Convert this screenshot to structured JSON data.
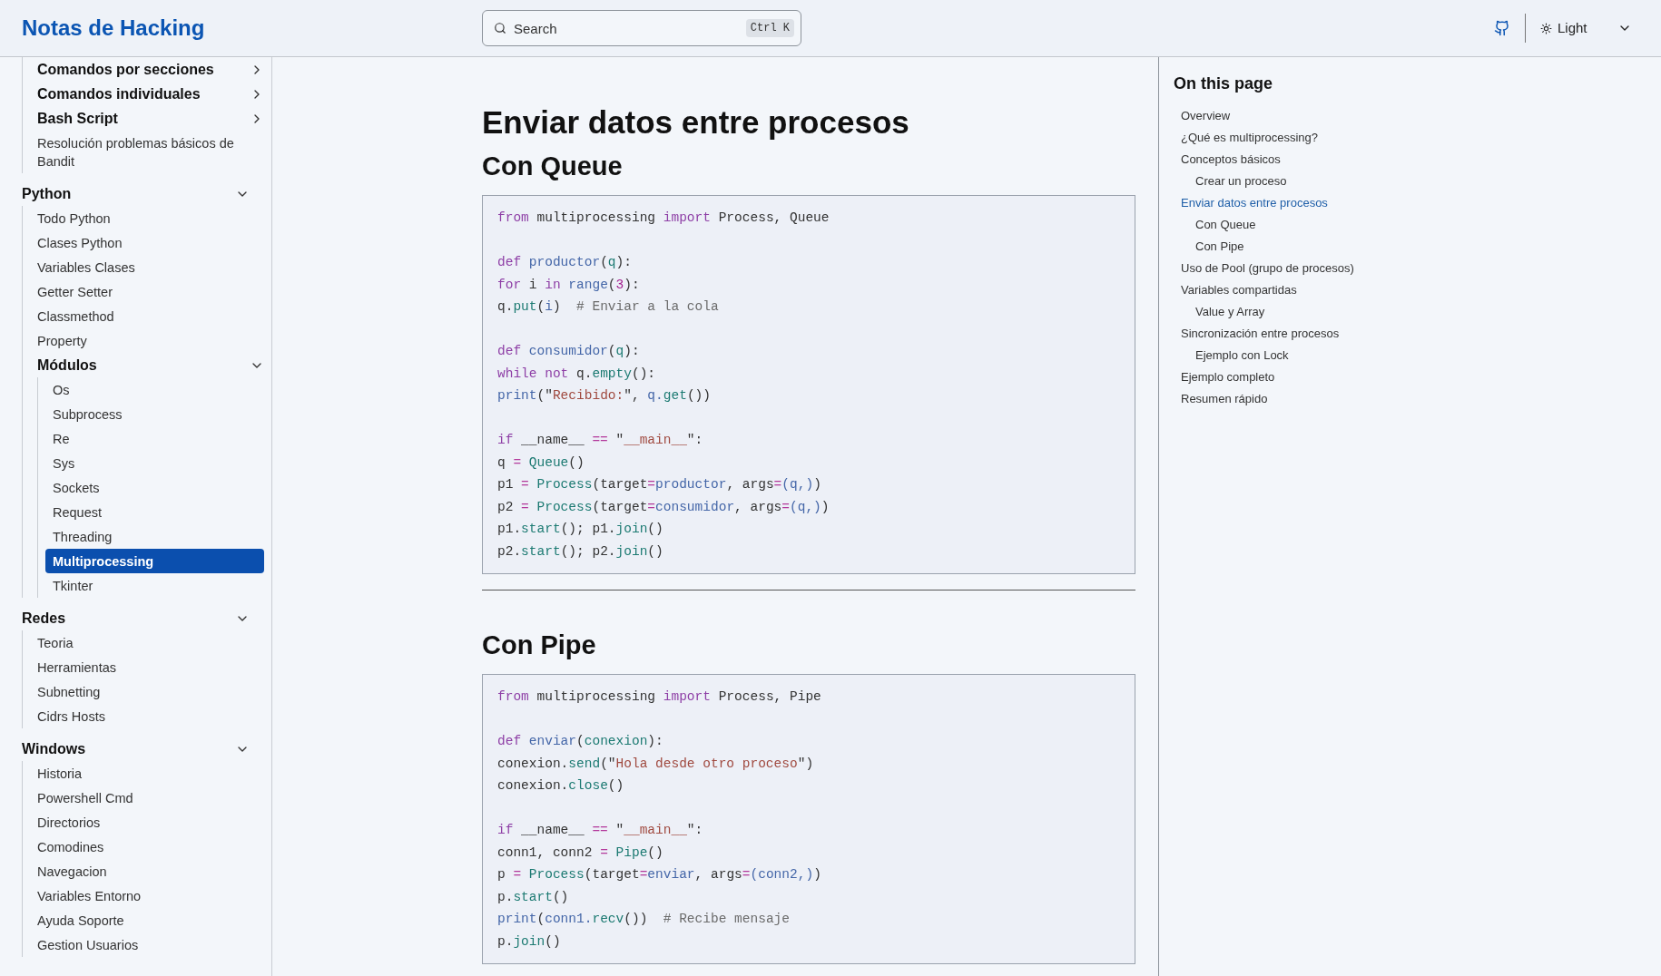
{
  "header": {
    "site_title": "Notas de Hacking",
    "search": {
      "placeholder": "Search",
      "shortcut": "Ctrl K"
    },
    "theme": {
      "label": "Light"
    }
  },
  "sidebar": {
    "continued_items": [
      {
        "label": "Comandos por secciones",
        "kind": "folder",
        "expanded": false,
        "selected": false
      },
      {
        "label": "Comandos individuales",
        "kind": "folder",
        "expanded": false,
        "selected": false
      },
      {
        "label": "Bash Script",
        "kind": "folder",
        "expanded": false,
        "selected": false
      },
      {
        "label": "Resolución problemas básicos de Bandit",
        "kind": "page",
        "selected": false
      }
    ],
    "sections": [
      {
        "label": "Python",
        "expanded": true,
        "children": [
          {
            "label": "Todo Python",
            "kind": "page",
            "selected": false
          },
          {
            "label": "Clases Python",
            "kind": "page",
            "selected": false
          },
          {
            "label": "Variables Clases",
            "kind": "page",
            "selected": false
          },
          {
            "label": "Getter Setter",
            "kind": "page",
            "selected": false
          },
          {
            "label": "Classmethod",
            "kind": "page",
            "selected": false
          },
          {
            "label": "Property",
            "kind": "page",
            "selected": false
          },
          {
            "label": "Módulos",
            "kind": "folder",
            "expanded": true,
            "selected": false,
            "children": [
              {
                "label": "Os",
                "kind": "page",
                "selected": false
              },
              {
                "label": "Subprocess",
                "kind": "page",
                "selected": false
              },
              {
                "label": "Re",
                "kind": "page",
                "selected": false
              },
              {
                "label": "Sys",
                "kind": "page",
                "selected": false
              },
              {
                "label": "Sockets",
                "kind": "page",
                "selected": false
              },
              {
                "label": "Request",
                "kind": "page",
                "selected": false
              },
              {
                "label": "Threading",
                "kind": "page",
                "selected": false
              },
              {
                "label": "Multiprocessing",
                "kind": "page",
                "selected": true
              },
              {
                "label": "Tkinter",
                "kind": "page",
                "selected": false
              }
            ]
          }
        ]
      },
      {
        "label": "Redes",
        "expanded": true,
        "children": [
          {
            "label": "Teoria",
            "kind": "page",
            "selected": false
          },
          {
            "label": "Herramientas",
            "kind": "page",
            "selected": false
          },
          {
            "label": "Subnetting",
            "kind": "page",
            "selected": false
          },
          {
            "label": "Cidrs Hosts",
            "kind": "page",
            "selected": false
          }
        ]
      },
      {
        "label": "Windows",
        "expanded": true,
        "children": [
          {
            "label": "Historia",
            "kind": "page",
            "selected": false
          },
          {
            "label": "Powershell Cmd",
            "kind": "page",
            "selected": false
          },
          {
            "label": "Directorios",
            "kind": "page",
            "selected": false
          },
          {
            "label": "Comodines",
            "kind": "page",
            "selected": false
          },
          {
            "label": "Navegacion",
            "kind": "page",
            "selected": false
          },
          {
            "label": "Variables Entorno",
            "kind": "page",
            "selected": false
          },
          {
            "label": "Ayuda Soporte",
            "kind": "page",
            "selected": false
          },
          {
            "label": "Gestion Usuarios",
            "kind": "page",
            "selected": false
          }
        ]
      }
    ]
  },
  "content": {
    "title": "Enviar datos entre procesos",
    "sections": [
      {
        "heading": "Con Queue",
        "divider_after": true,
        "code": [
          {
            "kind": "code",
            "tokens": [
              {
                "kind": "keyword",
                "text": "from"
              },
              {
                "kind": "plain",
                "text": " multiprocessing "
              },
              {
                "kind": "keyword",
                "text": "import"
              },
              {
                "kind": "plain",
                "text": " Process, Queue"
              }
            ]
          },
          {
            "kind": "blank"
          },
          {
            "kind": "code",
            "tokens": [
              {
                "kind": "keyword",
                "text": "def"
              },
              {
                "kind": "function",
                "text": " productor"
              },
              {
                "kind": "plain",
                "text": "("
              },
              {
                "kind": "call",
                "text": "q"
              },
              {
                "kind": "plain",
                "text": "):"
              }
            ]
          },
          {
            "kind": "code",
            "tokens": [
              {
                "kind": "keyword",
                "text": "for"
              },
              {
                "kind": "plain",
                "text": " i "
              },
              {
                "kind": "keyword",
                "text": "in"
              },
              {
                "kind": "function",
                "text": " range"
              },
              {
                "kind": "plain",
                "text": "("
              },
              {
                "kind": "number",
                "text": "3"
              },
              {
                "kind": "plain",
                "text": "):"
              }
            ]
          },
          {
            "kind": "code",
            "tokens": [
              {
                "kind": "plain",
                "text": "q."
              },
              {
                "kind": "call",
                "text": "put"
              },
              {
                "kind": "plain",
                "text": "("
              },
              {
                "kind": "function",
                "text": "i"
              },
              {
                "kind": "plain",
                "text": ")"
              },
              {
                "kind": "comment",
                "text": "  # Enviar a la cola"
              }
            ]
          },
          {
            "kind": "blank"
          },
          {
            "kind": "code",
            "tokens": [
              {
                "kind": "keyword",
                "text": "def"
              },
              {
                "kind": "function",
                "text": " consumidor"
              },
              {
                "kind": "plain",
                "text": "("
              },
              {
                "kind": "call",
                "text": "q"
              },
              {
                "kind": "plain",
                "text": "):"
              }
            ]
          },
          {
            "kind": "code",
            "tokens": [
              {
                "kind": "keyword",
                "text": "while not"
              },
              {
                "kind": "plain",
                "text": " q."
              },
              {
                "kind": "call",
                "text": "empty"
              },
              {
                "kind": "plain",
                "text": "():"
              }
            ]
          },
          {
            "kind": "code",
            "tokens": [
              {
                "kind": "function",
                "text": "print"
              },
              {
                "kind": "plain",
                "text": "(\""
              },
              {
                "kind": "string",
                "text": "Recibido:"
              },
              {
                "kind": "plain",
                "text": "\", "
              },
              {
                "kind": "function",
                "text": "q."
              },
              {
                "kind": "call",
                "text": "get"
              },
              {
                "kind": "plain",
                "text": "())"
              }
            ]
          },
          {
            "kind": "blank"
          },
          {
            "kind": "code",
            "tokens": [
              {
                "kind": "keyword",
                "text": "if"
              },
              {
                "kind": "plain",
                "text": " __name__ "
              },
              {
                "kind": "operator",
                "text": "=="
              },
              {
                "kind": "plain",
                "text": " \""
              },
              {
                "kind": "string",
                "text": "__main__"
              },
              {
                "kind": "plain",
                "text": "\":"
              }
            ]
          },
          {
            "kind": "code",
            "tokens": [
              {
                "kind": "plain",
                "text": "q "
              },
              {
                "kind": "operator",
                "text": "="
              },
              {
                "kind": "call",
                "text": " Queue"
              },
              {
                "kind": "plain",
                "text": "()"
              }
            ]
          },
          {
            "kind": "code",
            "tokens": [
              {
                "kind": "plain",
                "text": "p1 "
              },
              {
                "kind": "operator",
                "text": "="
              },
              {
                "kind": "call",
                "text": " Process"
              },
              {
                "kind": "plain",
                "text": "(target"
              },
              {
                "kind": "operator",
                "text": "="
              },
              {
                "kind": "function",
                "text": "productor"
              },
              {
                "kind": "plain",
                "text": ", args"
              },
              {
                "kind": "operator",
                "text": "="
              },
              {
                "kind": "function",
                "text": "(q,)"
              },
              {
                "kind": "plain",
                "text": ")"
              }
            ]
          },
          {
            "kind": "code",
            "tokens": [
              {
                "kind": "plain",
                "text": "p2 "
              },
              {
                "kind": "operator",
                "text": "="
              },
              {
                "kind": "call",
                "text": " Process"
              },
              {
                "kind": "plain",
                "text": "(target"
              },
              {
                "kind": "operator",
                "text": "="
              },
              {
                "kind": "function",
                "text": "consumidor"
              },
              {
                "kind": "plain",
                "text": ", args"
              },
              {
                "kind": "operator",
                "text": "="
              },
              {
                "kind": "function",
                "text": "(q,)"
              },
              {
                "kind": "plain",
                "text": ")"
              }
            ]
          },
          {
            "kind": "code",
            "tokens": [
              {
                "kind": "plain",
                "text": "p1."
              },
              {
                "kind": "call",
                "text": "start"
              },
              {
                "kind": "plain",
                "text": "(); p1."
              },
              {
                "kind": "call",
                "text": "join"
              },
              {
                "kind": "plain",
                "text": "()"
              }
            ]
          },
          {
            "kind": "code",
            "tokens": [
              {
                "kind": "plain",
                "text": "p2."
              },
              {
                "kind": "call",
                "text": "start"
              },
              {
                "kind": "plain",
                "text": "(); p2."
              },
              {
                "kind": "call",
                "text": "join"
              },
              {
                "kind": "plain",
                "text": "()"
              }
            ]
          }
        ]
      },
      {
        "heading": "Con Pipe",
        "code": [
          {
            "kind": "code",
            "tokens": [
              {
                "kind": "keyword",
                "text": "from"
              },
              {
                "kind": "plain",
                "text": " multiprocessing "
              },
              {
                "kind": "keyword",
                "text": "import"
              },
              {
                "kind": "plain",
                "text": " Process, Pipe"
              }
            ]
          },
          {
            "kind": "blank"
          },
          {
            "kind": "code",
            "tokens": [
              {
                "kind": "keyword",
                "text": "def"
              },
              {
                "kind": "function",
                "text": " enviar"
              },
              {
                "kind": "plain",
                "text": "("
              },
              {
                "kind": "call",
                "text": "conexion"
              },
              {
                "kind": "plain",
                "text": "):"
              }
            ]
          },
          {
            "kind": "code",
            "tokens": [
              {
                "kind": "plain",
                "text": "conexion."
              },
              {
                "kind": "call",
                "text": "send"
              },
              {
                "kind": "plain",
                "text": "(\""
              },
              {
                "kind": "string",
                "text": "Hola desde otro proceso"
              },
              {
                "kind": "plain",
                "text": "\")"
              }
            ]
          },
          {
            "kind": "code",
            "tokens": [
              {
                "kind": "plain",
                "text": "conexion."
              },
              {
                "kind": "call",
                "text": "close"
              },
              {
                "kind": "plain",
                "text": "()"
              }
            ]
          },
          {
            "kind": "blank"
          },
          {
            "kind": "code",
            "tokens": [
              {
                "kind": "keyword",
                "text": "if"
              },
              {
                "kind": "plain",
                "text": " __name__ "
              },
              {
                "kind": "operator",
                "text": "=="
              },
              {
                "kind": "plain",
                "text": " \""
              },
              {
                "kind": "string",
                "text": "__main__"
              },
              {
                "kind": "plain",
                "text": "\":"
              }
            ]
          },
          {
            "kind": "code",
            "tokens": [
              {
                "kind": "plain",
                "text": "conn1, conn2 "
              },
              {
                "kind": "operator",
                "text": "="
              },
              {
                "kind": "call",
                "text": " Pipe"
              },
              {
                "kind": "plain",
                "text": "()"
              }
            ]
          },
          {
            "kind": "code",
            "tokens": [
              {
                "kind": "plain",
                "text": "p "
              },
              {
                "kind": "operator",
                "text": "="
              },
              {
                "kind": "call",
                "text": " Process"
              },
              {
                "kind": "plain",
                "text": "(target"
              },
              {
                "kind": "operator",
                "text": "="
              },
              {
                "kind": "function",
                "text": "enviar"
              },
              {
                "kind": "plain",
                "text": ", args"
              },
              {
                "kind": "operator",
                "text": "="
              },
              {
                "kind": "function",
                "text": "(conn2,)"
              },
              {
                "kind": "plain",
                "text": ")"
              }
            ]
          },
          {
            "kind": "code",
            "tokens": [
              {
                "kind": "plain",
                "text": "p."
              },
              {
                "kind": "call",
                "text": "start"
              },
              {
                "kind": "plain",
                "text": "()"
              }
            ]
          },
          {
            "kind": "code",
            "tokens": [
              {
                "kind": "function",
                "text": "print"
              },
              {
                "kind": "plain",
                "text": "("
              },
              {
                "kind": "function",
                "text": "conn1."
              },
              {
                "kind": "call",
                "text": "recv"
              },
              {
                "kind": "plain",
                "text": "())"
              },
              {
                "kind": "comment",
                "text": "  # Recibe mensaje"
              }
            ]
          },
          {
            "kind": "code",
            "tokens": [
              {
                "kind": "plain",
                "text": "p."
              },
              {
                "kind": "call",
                "text": "join"
              },
              {
                "kind": "plain",
                "text": "()"
              }
            ]
          }
        ]
      }
    ]
  },
  "toc": {
    "title": "On this page",
    "items": [
      {
        "label": "Overview",
        "selected": false
      },
      {
        "label": "¿Qué es multiprocessing?",
        "selected": false
      },
      {
        "label": "Conceptos básicos",
        "selected": false,
        "children": [
          {
            "label": "Crear un proceso",
            "selected": false
          }
        ]
      },
      {
        "label": "Enviar datos entre procesos",
        "selected": true,
        "children": [
          {
            "label": "Con Queue",
            "selected": false
          },
          {
            "label": "Con Pipe",
            "selected": false
          }
        ]
      },
      {
        "label": "Uso de Pool (grupo de procesos)",
        "selected": false
      },
      {
        "label": "Variables compartidas",
        "selected": false,
        "children": [
          {
            "label": "Value y Array",
            "selected": false
          }
        ]
      },
      {
        "label": "Sincronización entre procesos",
        "selected": false,
        "children": [
          {
            "label": "Ejemplo con Lock",
            "selected": false
          }
        ]
      },
      {
        "label": "Ejemplo completo",
        "selected": false
      },
      {
        "label": "Resumen rápido",
        "selected": false
      }
    ]
  }
}
